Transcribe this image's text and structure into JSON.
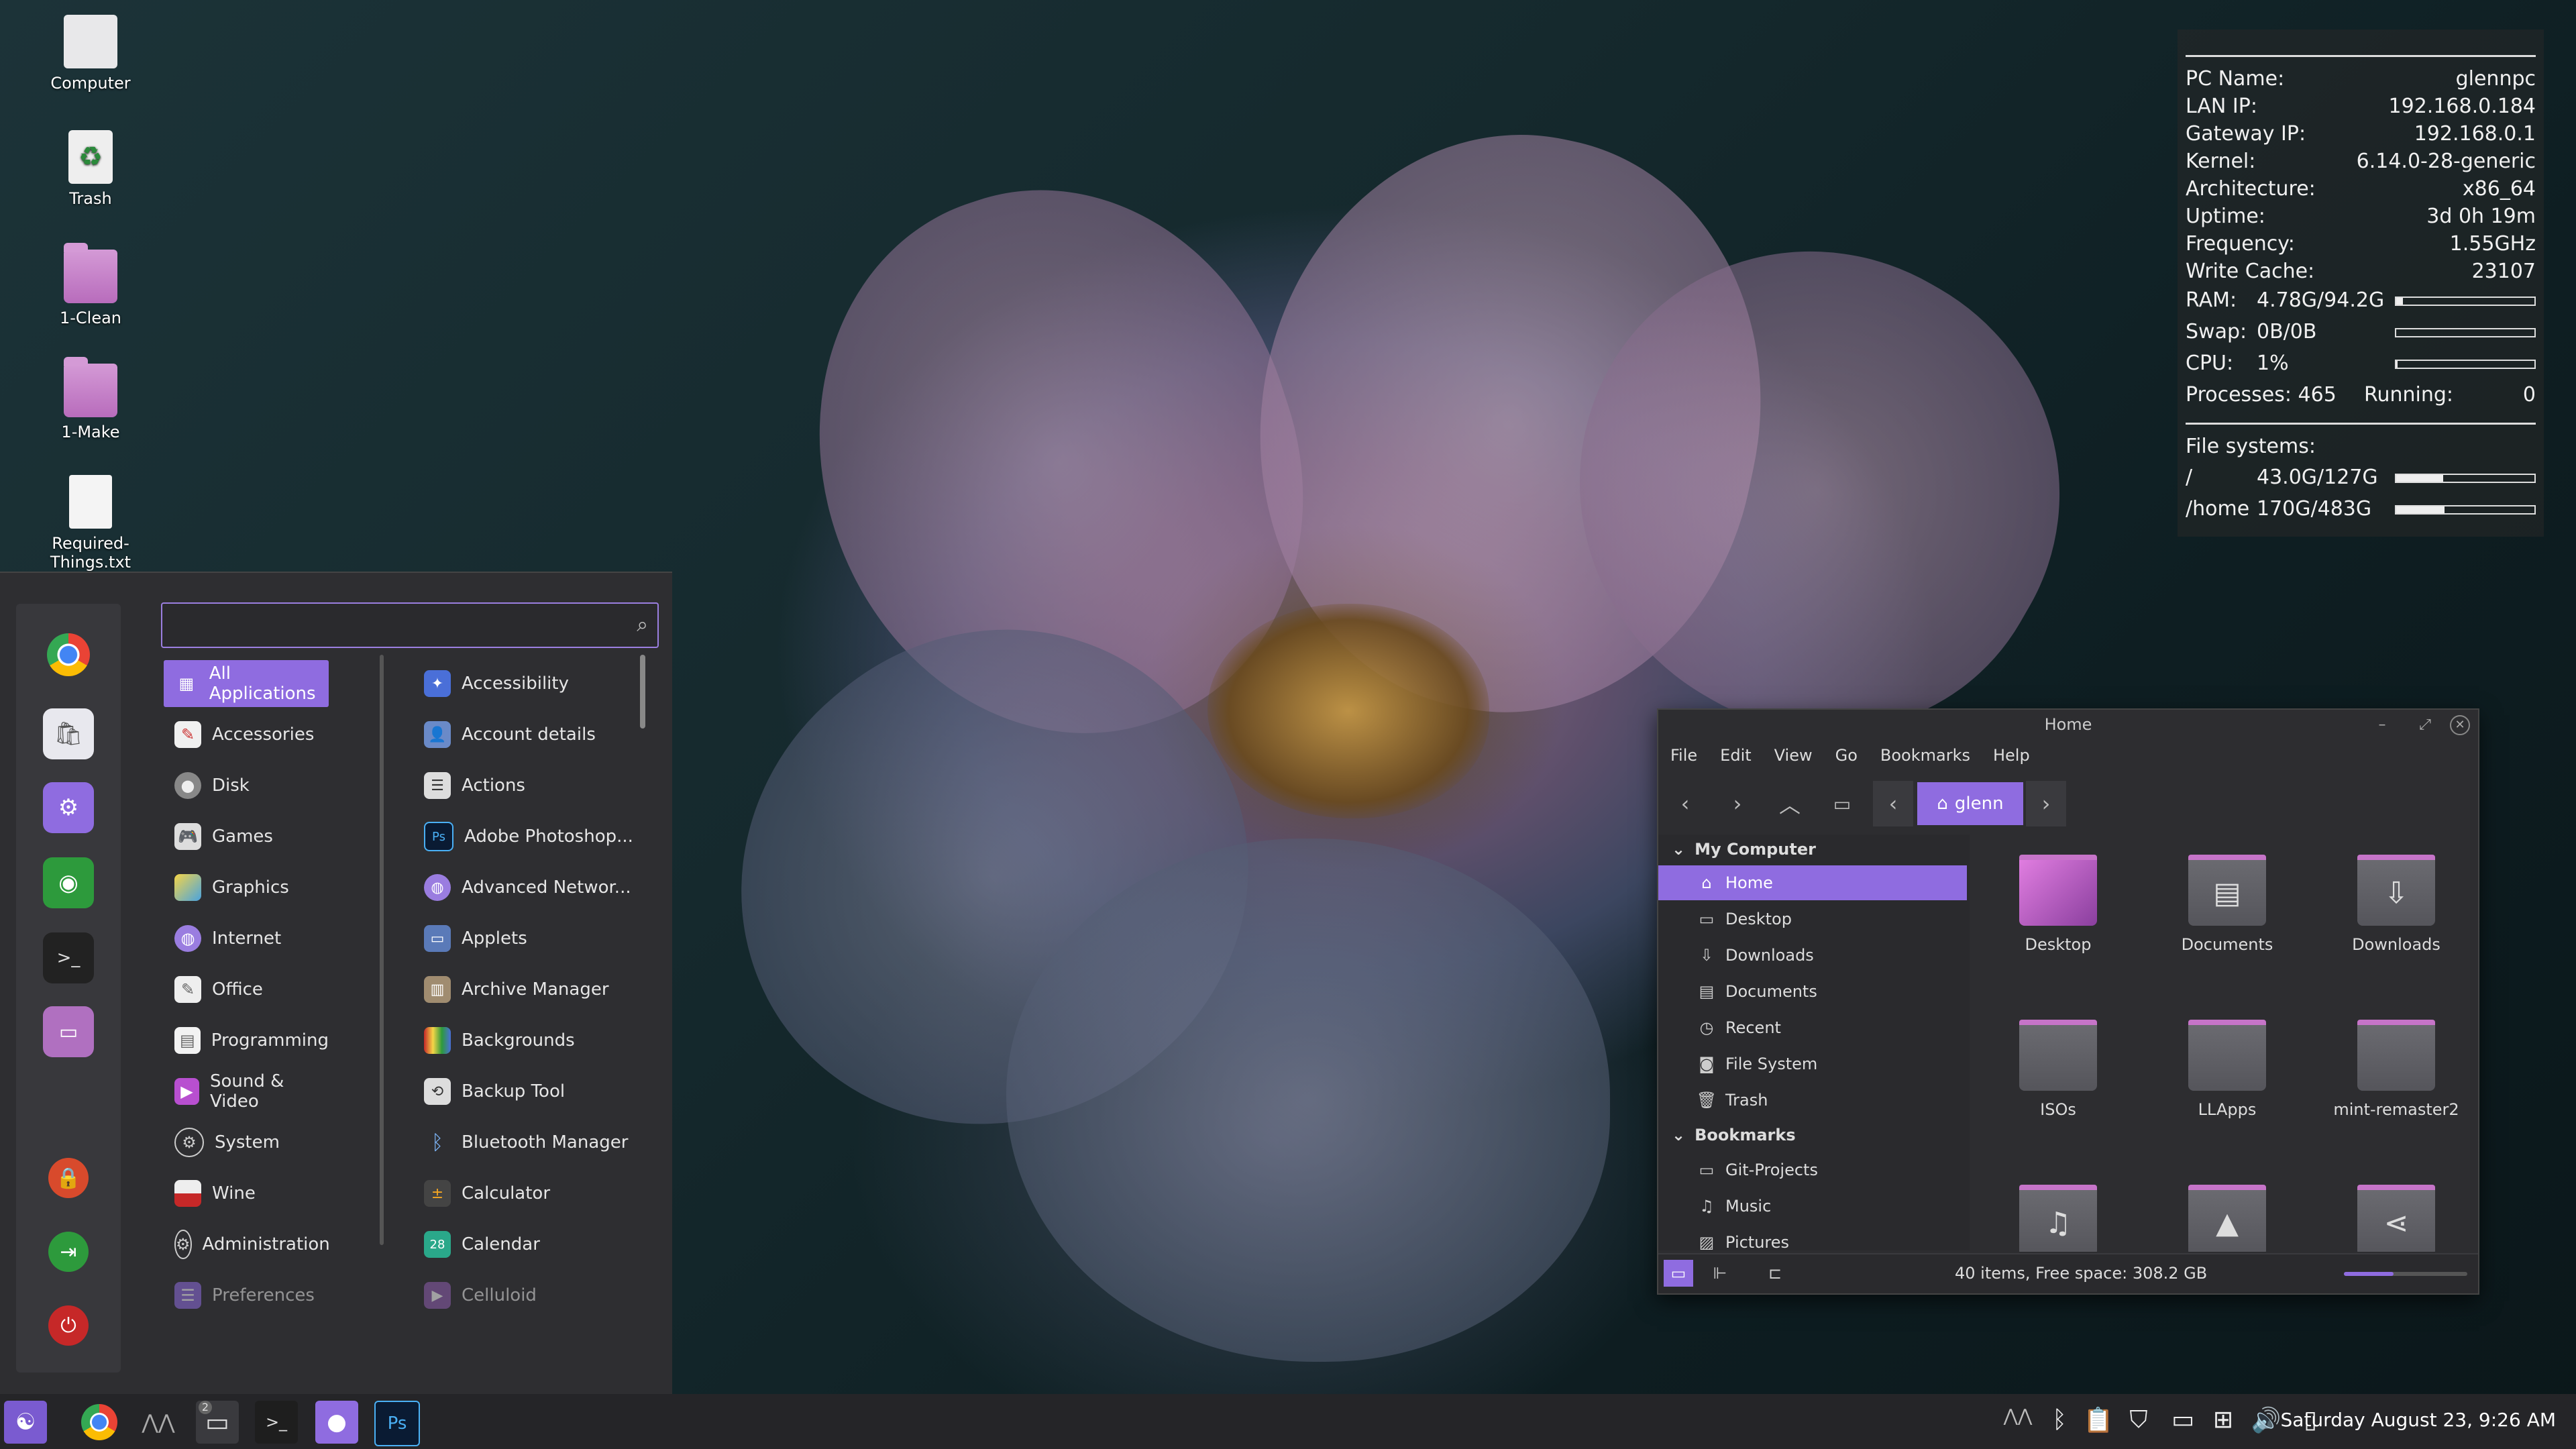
{
  "desktop": {
    "icons": [
      {
        "label": "Computer",
        "icon": "computer-icon"
      },
      {
        "label": "Trash",
        "icon": "trash-icon"
      },
      {
        "label": "1-Clean",
        "icon": "folder-icon"
      },
      {
        "label": "1-Make",
        "icon": "folder-icon"
      },
      {
        "label": "Required-Things.txt",
        "icon": "text-file-icon"
      }
    ]
  },
  "conky": {
    "rows": [
      {
        "k": "PC Name:",
        "v": "glennpc"
      },
      {
        "k": "LAN IP:",
        "v": "192.168.0.184"
      },
      {
        "k": "Gateway IP:",
        "v": "192.168.0.1"
      },
      {
        "k": "Kernel:",
        "v": "6.14.0-28-generic"
      },
      {
        "k": "Architecture:",
        "v": "x86_64"
      },
      {
        "k": "Uptime:",
        "v": "3d 0h 19m"
      },
      {
        "k": "Frequency:",
        "v": "1.55GHz"
      },
      {
        "k": "Write Cache:",
        "v": "23107"
      }
    ],
    "ram": {
      "k": "RAM:",
      "v": "4.78G/94.2G",
      "level": 0.05
    },
    "swap": {
      "k": "Swap:",
      "v": "0B/0B",
      "level": 0.0
    },
    "cpu": {
      "k": "CPU:",
      "v": "1%",
      "level": 0.01
    },
    "processes": {
      "k": "Processes: 465",
      "running_k": "Running:",
      "running_v": "0"
    },
    "fs_title": "File systems:",
    "fs": [
      {
        "mount": "/",
        "usage": "43.0G/127G",
        "level": 0.34
      },
      {
        "mount": "/home",
        "usage": "170G/483G",
        "level": 0.35
      }
    ]
  },
  "menu": {
    "search": {
      "placeholder": "",
      "value": ""
    },
    "favorites": [
      "chrome-icon",
      "software-store-icon",
      "settings-icon",
      "app-icon",
      "terminal-icon",
      "files-icon"
    ],
    "session": [
      "lock-icon",
      "logout-icon",
      "power-icon"
    ],
    "categories": [
      "All Applications",
      "Accessories",
      "Disk",
      "Games",
      "Graphics",
      "Internet",
      "Office",
      "Programming",
      "Sound & Video",
      "System",
      "Wine",
      "Administration",
      "Preferences"
    ],
    "apps": [
      "Accessibility",
      "Account details",
      "Actions",
      "Adobe Photoshop...",
      "Advanced Networ...",
      "Applets",
      "Archive Manager",
      "Backgrounds",
      "Backup Tool",
      "Bluetooth Manager",
      "Calculator",
      "Calendar",
      "Celluloid"
    ],
    "calendar_badge": "28",
    "photoshop_badge": "Ps"
  },
  "filemanager": {
    "title": "Home",
    "menu": [
      "File",
      "Edit",
      "View",
      "Go",
      "Bookmarks",
      "Help"
    ],
    "crumb": "glenn",
    "sections": {
      "my_computer": "My Computer",
      "bookmarks": "Bookmarks"
    },
    "places": [
      "Home",
      "Desktop",
      "Downloads",
      "Documents",
      "Recent",
      "File System",
      "Trash"
    ],
    "bookmarks": [
      "Git-Projects",
      "Music",
      "Pictures"
    ],
    "items": [
      "Desktop",
      "Documents",
      "Downloads",
      "ISOs",
      "LLApps",
      "mint-remaster2",
      "",
      "",
      ""
    ],
    "status": "40 items, Free space: 308.2 GB",
    "zoom_level": 0.4
  },
  "taskbar": {
    "apps": [
      "menu-icon",
      "chrome-icon",
      "vm-icon",
      "files-icon",
      "terminal-icon",
      "github-icon",
      "photoshop-icon"
    ],
    "files_badge": "2",
    "photoshop_label": "Ps",
    "clock": "Saturday August 23, 9:26 AM"
  }
}
